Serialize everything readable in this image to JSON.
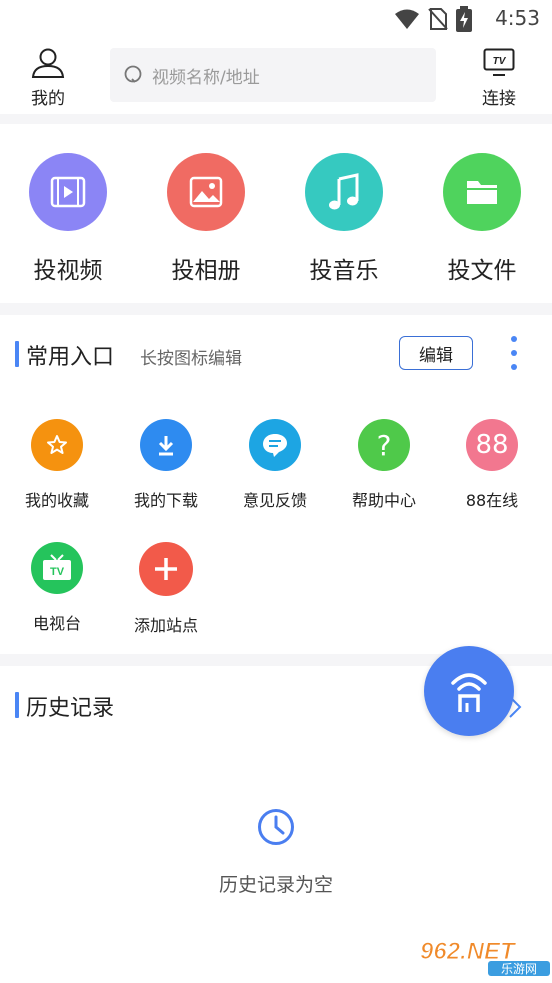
{
  "status_bar": {
    "time": "4:53"
  },
  "top_bar": {
    "profile_label": "我的",
    "search_placeholder": "视频名称/地址",
    "connect_label": "连接",
    "tv_badge": "TV"
  },
  "cast_buttons": [
    {
      "label": "投视频",
      "icon": "video-icon",
      "color": "#8b85f5"
    },
    {
      "label": "投相册",
      "icon": "photo-icon",
      "color": "#f06b63"
    },
    {
      "label": "投音乐",
      "icon": "music-icon",
      "color": "#36c9c0"
    },
    {
      "label": "投文件",
      "icon": "folder-icon",
      "color": "#4fd35d"
    }
  ],
  "common_entries": {
    "title": "常用入口",
    "hint": "长按图标编辑",
    "edit_label": "编辑",
    "items": [
      {
        "label": "我的收藏",
        "icon": "star-icon",
        "color": "#f5920f"
      },
      {
        "label": "我的下载",
        "icon": "download-icon",
        "color": "#2e8bf0"
      },
      {
        "label": "意见反馈",
        "icon": "feedback-icon",
        "color": "#1da5e3"
      },
      {
        "label": "帮助中心",
        "icon": "help-icon",
        "color": "#4fc94a",
        "glyph": "?"
      },
      {
        "label": "88在线",
        "icon": "88-icon",
        "color": "#f2778f",
        "glyph": "88"
      },
      {
        "label": "电视台",
        "icon": "tv-station-icon",
        "color": "#25c45c",
        "glyph": "TV"
      },
      {
        "label": "添加站点",
        "icon": "add-icon",
        "color": "#f25a4a"
      }
    ]
  },
  "history": {
    "title": "历史记录",
    "empty_text": "历史记录为空"
  },
  "watermark": {
    "text": "962.NET",
    "sub": "乐游网"
  }
}
